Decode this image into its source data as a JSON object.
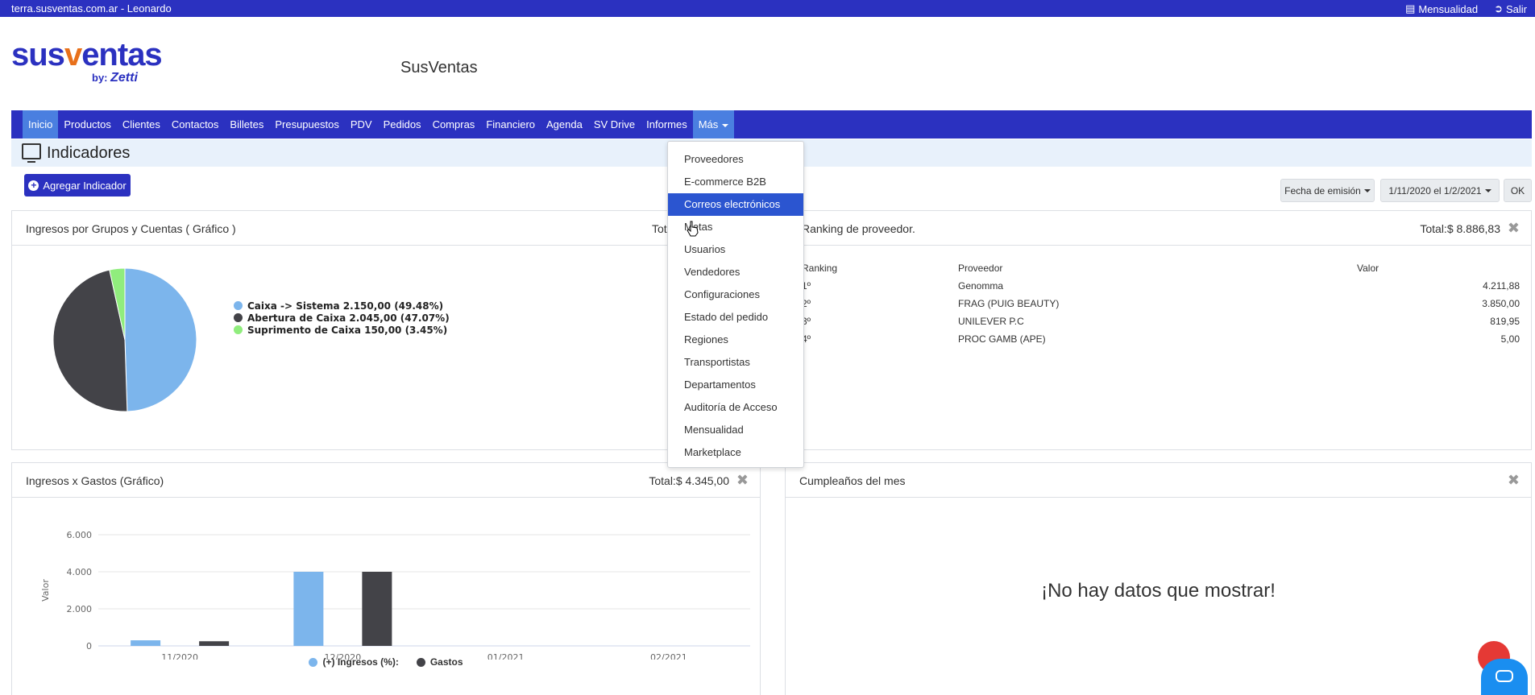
{
  "topbar": {
    "site": "terra.susventas.com.ar - Leonardo",
    "mensualidad": "Mensualidad",
    "salir": "Salir"
  },
  "logo": {
    "main_a": "sus",
    "main_b": "v",
    "main_c": "entas",
    "by": "by:",
    "brand": "Zetti"
  },
  "app_title": "SusVentas",
  "nav": {
    "items": [
      "Inicio",
      "Productos",
      "Clientes",
      "Contactos",
      "Billetes",
      "Presupuestos",
      "PDV",
      "Pedidos",
      "Compras",
      "Financiero",
      "Agenda",
      "SV Drive",
      "Informes",
      "Más"
    ]
  },
  "page": {
    "title": "Indicadores",
    "add_button": "Agregar Indicador"
  },
  "filters": {
    "date_type": "Fecha de emisión",
    "date_range": "1/11/2020 el 1/2/2021",
    "ok": "OK"
  },
  "dropdown": {
    "items": [
      "Proveedores",
      "E-commerce B2B",
      "Correos electrónicos",
      "Metas",
      "Usuarios",
      "Vendedores",
      "Configuraciones",
      "Estado del pedido",
      "Regiones",
      "Transportistas",
      "Departamentos",
      "Auditoría de Acceso",
      "Mensualidad",
      "Marketplace"
    ],
    "active_index": 2
  },
  "card_pie": {
    "title": "Ingresos por Grupos y Cuentas ( Gráfico )",
    "total": "Tot"
  },
  "card_rank": {
    "title": "Ranking de proveedor.",
    "total": "Total:$ 8.886,83",
    "headers": [
      "Ranking",
      "Proveedor",
      "Valor"
    ],
    "rows": [
      {
        "rank": "1º",
        "name": "Genomma",
        "value": "4.211,88"
      },
      {
        "rank": "2º",
        "name": "FRAG (PUIG BEAUTY)",
        "value": "3.850,00"
      },
      {
        "rank": "3º",
        "name": "UNILEVER P.C",
        "value": "819,95"
      },
      {
        "rank": "4º",
        "name": "PROC GAMB (APE)",
        "value": "5,00"
      }
    ]
  },
  "card_bar": {
    "title": "Ingresos x Gastos (Gráfico)",
    "total": "Total:$ 4.345,00"
  },
  "card_birthday": {
    "title": "Cumpleaños del mes",
    "empty": "¡No hay datos que mostrar!"
  },
  "colors": {
    "primary": "#2b31c0",
    "accent_blue": "#7cb5ec",
    "dark": "#434348",
    "green": "#90ed7d"
  },
  "chart_data": [
    {
      "type": "pie",
      "categories": [
        "Caixa -> Sistema",
        "Abertura de Caixa",
        "Suprimento de Caixa"
      ],
      "values": [
        2150.0,
        2045.0,
        150.0
      ],
      "labels": [
        "Caixa -> Sistema 2.150,00 (49.48%)",
        "Abertura de Caixa 2.045,00 (47.07%)",
        "Suprimento de Caixa 150,00 (3.45%)"
      ],
      "colors": [
        "#7cb5ec",
        "#434348",
        "#90ed7d"
      ],
      "legend": "right"
    },
    {
      "type": "bar",
      "categories": [
        "11/2020",
        "12/2020",
        "01/2021",
        "02/2021"
      ],
      "series": [
        {
          "name": "(+) Ingresos (%):",
          "values": [
            300,
            4000,
            0,
            0
          ],
          "color": "#7cb5ec"
        },
        {
          "name": "Gastos",
          "values": [
            250,
            4000,
            0,
            0
          ],
          "color": "#434348"
        }
      ],
      "ylabel": "Valor",
      "yticks": [
        "0",
        "2.000",
        "4.000",
        "6.000"
      ],
      "ylim": [
        0,
        6000
      ],
      "grid": true,
      "legend": "bottom"
    }
  ]
}
